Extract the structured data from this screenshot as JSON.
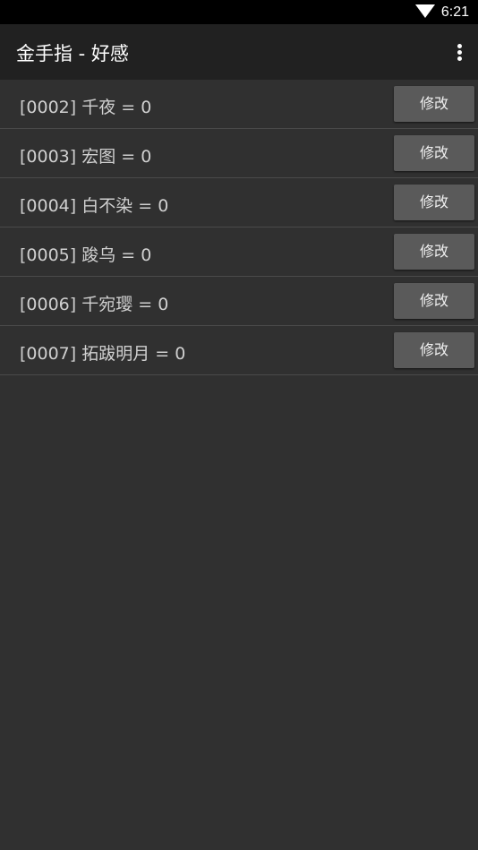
{
  "status_bar": {
    "time": "6:21",
    "icons": [
      "wifi-icon"
    ]
  },
  "app_bar": {
    "title": "金手指 - 好感",
    "menu_icon": "more-vert-icon"
  },
  "rows": [
    {
      "label": "[0002] 千夜 = 0",
      "button": "修改"
    },
    {
      "label": "[0003] 宏图 = 0",
      "button": "修改"
    },
    {
      "label": "[0004] 白不染 = 0",
      "button": "修改"
    },
    {
      "label": "[0005] 踆乌 = 0",
      "button": "修改"
    },
    {
      "label": "[0006] 千宛璎 = 0",
      "button": "修改"
    },
    {
      "label": "[0007] 拓跋明月 = 0",
      "button": "修改"
    }
  ],
  "colors": {
    "background": "#303030",
    "app_bar": "#212121",
    "button": "#5a5a5a",
    "divider": "#4a4a4a"
  }
}
